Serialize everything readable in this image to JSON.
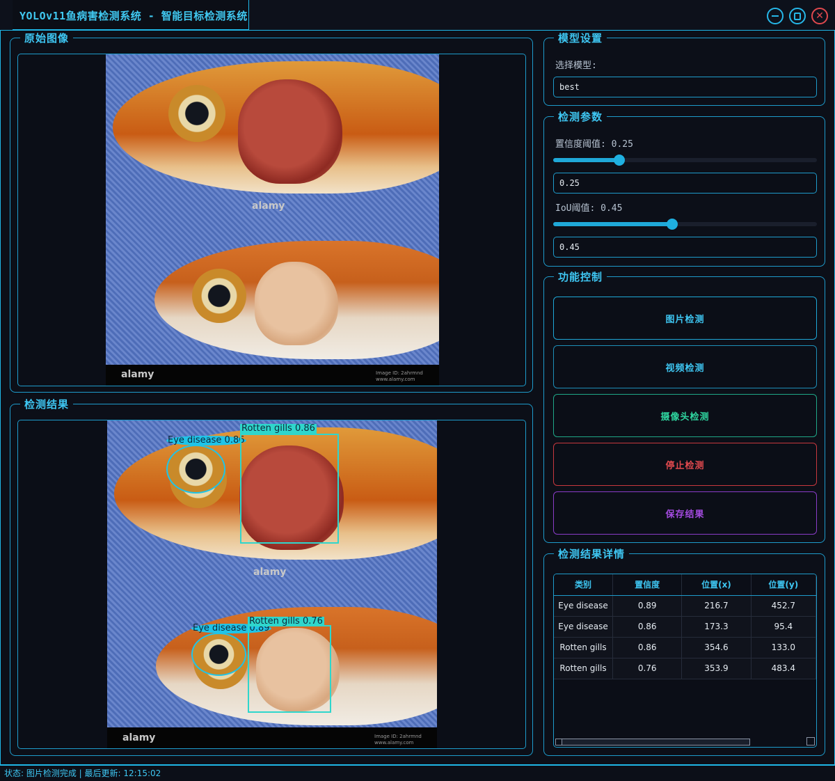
{
  "window": {
    "title": "YOLOv11鱼病害检测系统 - 智能目标检测系统"
  },
  "panels": {
    "original": {
      "title": "原始图像"
    },
    "result": {
      "title": "检测结果"
    },
    "model": {
      "title": "模型设置",
      "select_label": "选择模型:",
      "selected_model": "best"
    },
    "params": {
      "title": "检测参数",
      "conf_label": "置信度阈值: 0.25",
      "conf_value": "0.25",
      "conf_level": 0.25,
      "iou_label": "IoU阈值: 0.45",
      "iou_value": "0.45",
      "iou_level": 0.45
    },
    "controls": {
      "title": "功能控制",
      "image_detect": "图片检测",
      "video_detect": "视频检测",
      "camera_detect": "摄像头检测",
      "stop_detect": "停止检测",
      "save_result": "保存结果"
    },
    "details": {
      "title": "检测结果详情",
      "columns": [
        "类别",
        "置信度",
        "位置(x)",
        "位置(y)"
      ],
      "rows": [
        [
          "Eye disease",
          "0.89",
          "216.7",
          "452.7"
        ],
        [
          "Eye disease",
          "0.86",
          "173.3",
          "95.4"
        ],
        [
          "Rotten gills",
          "0.86",
          "354.6",
          "133.0"
        ],
        [
          "Rotten gills",
          "0.76",
          "353.9",
          "483.4"
        ]
      ]
    }
  },
  "image": {
    "watermark": "alamy",
    "watermark_small_1": "Image ID: 2ahrmnd",
    "watermark_small_2": "www.alamy.com"
  },
  "detections": [
    {
      "label": "Eye disease 0.86"
    },
    {
      "label": "Rotten gills 0.86"
    },
    {
      "label": "Eye disease 0.89"
    },
    {
      "label": "Rotten gills 0.76"
    }
  ],
  "status": {
    "text": "状态: 图片检测完成 | 最后更新: 12:15:02"
  },
  "colors": {
    "accent": "#3ec6f2",
    "border": "#1e9ccc",
    "stop": "#e0494e",
    "save": "#a44be0",
    "camera": "#2fd6a0"
  },
  "icons": [
    "minimize-icon",
    "maximize-icon",
    "close-icon"
  ]
}
